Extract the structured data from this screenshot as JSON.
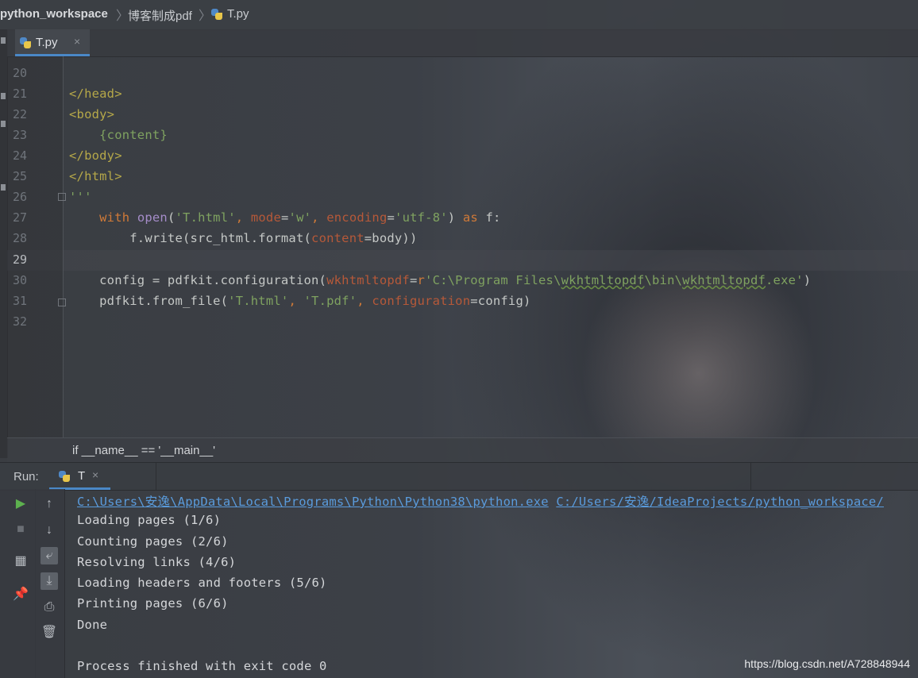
{
  "breadcrumb": {
    "project": "python_workspace",
    "folder": "博客制成pdf",
    "file": "T.py"
  },
  "editor_tab": {
    "label": "T.py",
    "close": "×"
  },
  "editor": {
    "line_numbers": [
      "20",
      "21",
      "22",
      "23",
      "24",
      "25",
      "26",
      "27",
      "28",
      "29",
      "30",
      "31",
      "32"
    ],
    "current_line": "29",
    "lines": {
      "l21": "</head>",
      "l22": "<body>",
      "l23_indent": "    ",
      "l23": "{content}",
      "l24": "</body>",
      "l25": "</html>",
      "l26": "'''",
      "l27_indent": "    ",
      "l27_kw": "with",
      "l27_sp1": " ",
      "l27_builtin": "open",
      "l27_p1": "(",
      "l27_s1": "'T.html'",
      "l27_c1": ", ",
      "l27_k1": "mode",
      "l27_eq1": "=",
      "l27_s2": "'w'",
      "l27_c2": ", ",
      "l27_k2": "encoding",
      "l27_eq2": "=",
      "l27_s3": "'utf-8'",
      "l27_p2": ") ",
      "l27_as": "as",
      "l27_end": " f:",
      "l28_pre": "        f.write(src_html.format(",
      "l28_kw": "content",
      "l28_post": "=body))",
      "l30_pre": "    config = pdfkit.configuration(",
      "l30_kw": "wkhtmltopdf",
      "l30_eq": "=",
      "l30_r": "r",
      "l30_s_a": "'C:\\Program Files\\",
      "l30_s_b": "wkhtmltopdf",
      "l30_s_c": "\\bin\\",
      "l30_s_d": "wkhtmltopdf",
      "l30_s_e": ".exe'",
      "l30_end": ")",
      "l31_pre": "    pdfkit.from_file(",
      "l31_s1": "'T.html'",
      "l31_c1": ", ",
      "l31_s2": "'T.pdf'",
      "l31_c2": ", ",
      "l31_kw": "configuration",
      "l31_end": "=config)"
    },
    "scope_crumb": "if __name__ == '__main__'"
  },
  "run_panel": {
    "label": "Run:",
    "tab": "T",
    "tab_close": "×",
    "cmd_exe": "C:\\Users\\安逸\\AppData\\Local\\Programs\\Python\\Python38\\python.exe",
    "cmd_script": "C:/Users/安逸/IdeaProjects/python_workspace/",
    "output": [
      "Loading pages (1/6)",
      "Counting pages (2/6)",
      "Resolving links (4/6)",
      "Loading headers and footers (5/6)",
      "Printing pages (6/6)",
      "Done",
      "",
      "Process finished with exit code 0"
    ]
  },
  "watermark": "https://blog.csdn.net/A728848944"
}
